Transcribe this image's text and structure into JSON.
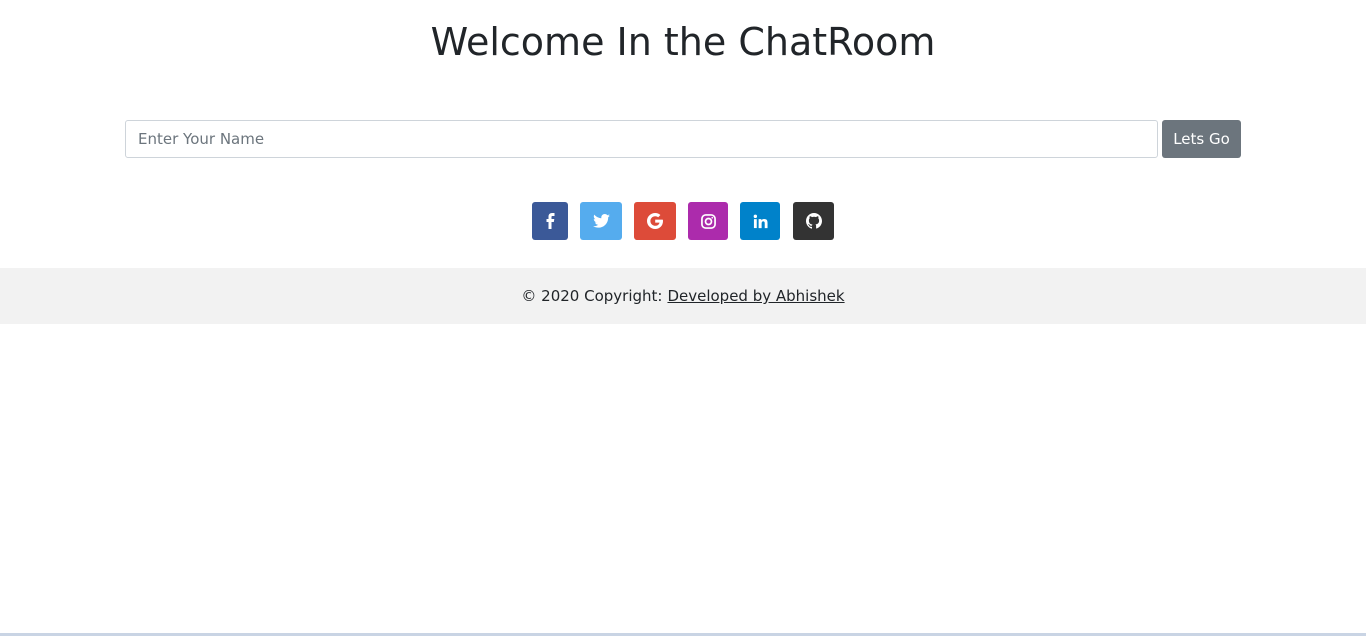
{
  "header": {
    "title": "Welcome In the ChatRoom"
  },
  "form": {
    "name_placeholder": "Enter Your Name",
    "name_value": "",
    "submit_label": "Lets Go"
  },
  "social": [
    {
      "name": "facebook",
      "icon": "facebook-icon",
      "color": "#3b5998"
    },
    {
      "name": "twitter",
      "icon": "twitter-icon",
      "color": "#55acee"
    },
    {
      "name": "google",
      "icon": "google-icon",
      "color": "#dd4b39"
    },
    {
      "name": "instagram",
      "icon": "instagram-icon",
      "color": "#ac2bac"
    },
    {
      "name": "linkedin",
      "icon": "linkedin-icon",
      "color": "#0082ca"
    },
    {
      "name": "github",
      "icon": "github-icon",
      "color": "#333333"
    }
  ],
  "footer": {
    "copyright": "© 2020 Copyright:",
    "link_text": "Developed by Abhishek"
  }
}
